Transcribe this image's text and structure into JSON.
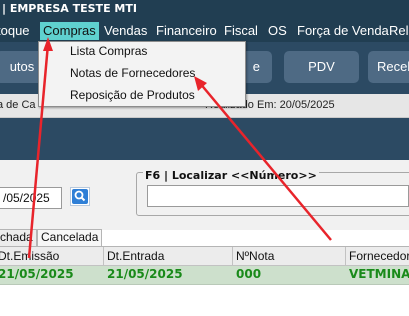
{
  "window": {
    "title": "| EMPRESA TESTE MTI"
  },
  "menubar": {
    "items": [
      "toque",
      "Compras",
      "Vendas",
      "Financeiro",
      "Fiscal",
      "OS",
      "Força de Venda",
      "Rela"
    ],
    "active": "Compras"
  },
  "dropdown": {
    "items": [
      "Lista Compras",
      "Notas de Fornecedores",
      "Reposição de Produtos"
    ]
  },
  "toolbar": {
    "buttons": [
      "utos",
      "e",
      "PDV",
      "Recel"
    ]
  },
  "status": {
    "left_text": "a de Ca",
    "right_text": "Realizado Em: 20/05/2025"
  },
  "search": {
    "date_value": "/05/2025",
    "localizar_label": "F6 | Localizar <<Número>>",
    "localizar_value": ""
  },
  "tabs": [
    "chada",
    "Cancelada"
  ],
  "grid": {
    "headers": [
      "Dt.Emissão",
      "Dt.Entrada",
      "NºNota",
      "Fornecedor"
    ],
    "rows": [
      [
        "21/05/2025",
        "21/05/2025",
        "000",
        "VETMINAS"
      ]
    ]
  },
  "colors": {
    "titlebar": "#213e52",
    "menu_active": "#5fd1cf",
    "toolbar": "#2c4a63",
    "row_highlight": "#cde0cc",
    "row_text": "#1a8a1a",
    "annotation": "#e8242b"
  }
}
